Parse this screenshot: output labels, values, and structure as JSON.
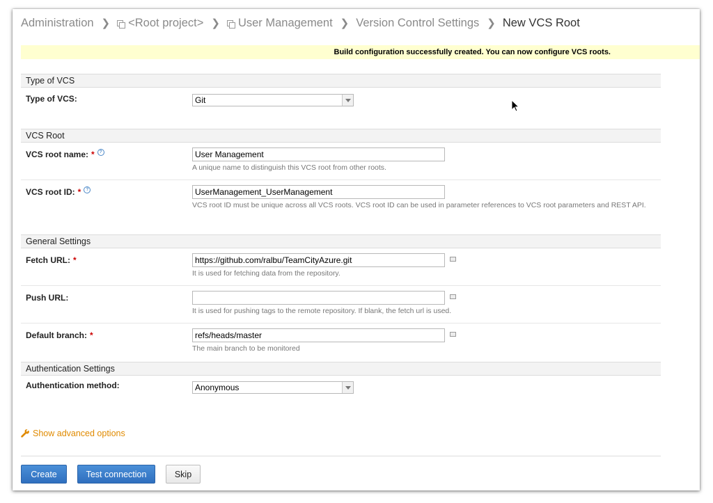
{
  "breadcrumb": {
    "items": [
      "Administration",
      "<Root project>",
      "User Management",
      "Version Control Settings"
    ],
    "current": "New VCS Root"
  },
  "notice": "Build configuration successfully created. You can now configure VCS roots.",
  "sections": {
    "type_of_vcs": "Type of VCS",
    "vcs_root": "VCS Root",
    "general": "General Settings",
    "auth": "Authentication Settings"
  },
  "fields": {
    "vcs_type": {
      "label": "Type of VCS:",
      "value": "Git"
    },
    "root_name": {
      "label": "VCS root name:",
      "value": "User Management",
      "hint": "A unique name to distinguish this VCS root from other roots."
    },
    "root_id": {
      "label": "VCS root ID:",
      "value": "UserManagement_UserManagement",
      "hint": "VCS root ID must be unique across all VCS roots. VCS root ID can be used in parameter references to VCS root parameters and REST API."
    },
    "fetch_url": {
      "label": "Fetch URL:",
      "value": "https://github.com/ralbu/TeamCityAzure.git",
      "hint": "It is used for fetching data from the repository."
    },
    "push_url": {
      "label": "Push URL:",
      "value": "",
      "hint": "It is used for pushing tags to the remote repository. If blank, the fetch url is used."
    },
    "default_branch": {
      "label": "Default branch:",
      "value": "refs/heads/master",
      "hint": "The main branch to be monitored"
    },
    "auth_method": {
      "label": "Authentication method:",
      "value": "Anonymous"
    }
  },
  "required_mark": "*",
  "help_mark": "?",
  "advanced_link": "Show advanced options",
  "buttons": {
    "create": "Create",
    "test": "Test connection",
    "skip": "Skip"
  },
  "colors": {
    "accent": "#2f6fbf",
    "link_orange": "#e08a00",
    "notice_bg": "#ffffd0",
    "required": "#cc0000"
  },
  "icons": [
    "chevron-right-icon",
    "project-icon",
    "help-icon",
    "wrench-icon",
    "dropdown-arrow-icon",
    "mouse-cursor-icon"
  ]
}
